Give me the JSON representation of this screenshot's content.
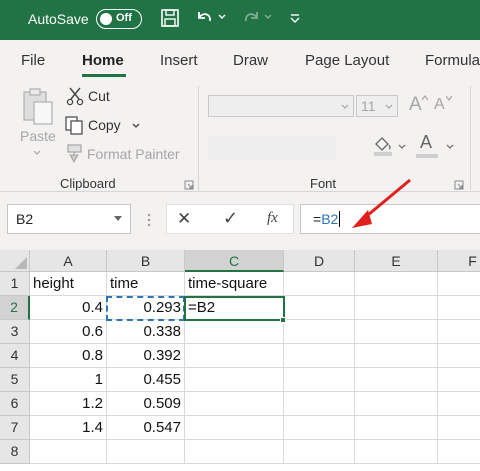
{
  "titlebar": {
    "autosave_label": "AutoSave",
    "autosave_state": "Off",
    "icons": [
      "save-icon",
      "undo-icon",
      "redo-icon",
      "customize-qat-icon"
    ],
    "accent_color": "#217346"
  },
  "ribbon_tabs": [
    {
      "label": "File",
      "active": false
    },
    {
      "label": "Home",
      "active": true
    },
    {
      "label": "Insert",
      "active": false
    },
    {
      "label": "Draw",
      "active": false
    },
    {
      "label": "Page Layout",
      "active": false
    },
    {
      "label": "Formula",
      "active": false
    }
  ],
  "clipboard": {
    "paste_label": "Paste",
    "cut_label": "Cut",
    "copy_label": "Copy",
    "format_painter_label": "Format Painter",
    "group_label": "Clipboard"
  },
  "font": {
    "font_name_value": "",
    "font_size_value": "11",
    "grow_label": "A",
    "shrink_label": "A",
    "font_color_label": "A",
    "group_label": "Font"
  },
  "formula_bar": {
    "name_box": "B2",
    "cancel_symbol": "✕",
    "enter_symbol": "✓",
    "fx_label": "fx",
    "formula_prefix": "=",
    "formula_ref": "B2"
  },
  "grid": {
    "columns": [
      "A",
      "B",
      "C",
      "D",
      "E",
      "F"
    ],
    "selected_column": "C",
    "rows": [
      "1",
      "2",
      "3",
      "4",
      "5",
      "6",
      "7",
      "8"
    ],
    "selected_row": "2",
    "cells": {
      "A1": "height",
      "B1": "time",
      "C1": "time-square",
      "A2": "0.4",
      "B2": "0.293",
      "C2": "=B2",
      "A3": "0.6",
      "B3": "0.338",
      "A4": "0.8",
      "B4": "0.392",
      "A5": "1",
      "B5": "0.455",
      "A6": "1.2",
      "B6": "0.509",
      "A7": "1.4",
      "B7": "0.547"
    }
  }
}
